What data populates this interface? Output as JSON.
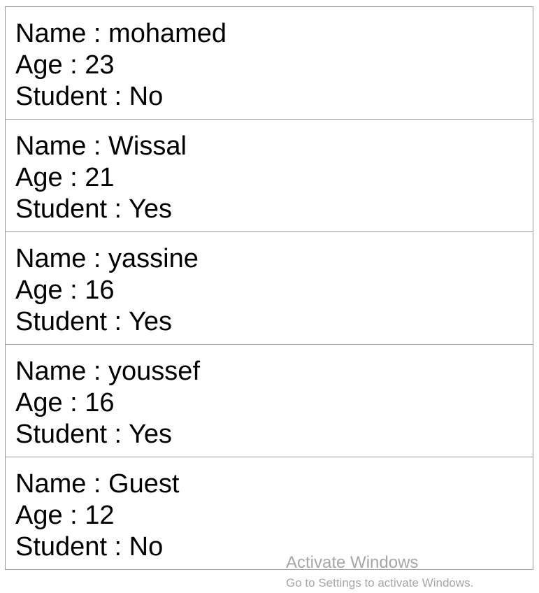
{
  "people": [
    {
      "name": "Name : mohamed",
      "age": "Age : 23",
      "student": "Student : No"
    },
    {
      "name": "Name : Wissal",
      "age": "Age : 21",
      "student": "Student : Yes"
    },
    {
      "name": "Name : yassine",
      "age": "Age : 16",
      "student": "Student : Yes"
    },
    {
      "name": "Name : youssef",
      "age": "Age : 16",
      "student": "Student : Yes"
    },
    {
      "name": "Name : Guest",
      "age": "Age : 12",
      "student": "Student : No"
    }
  ],
  "watermark": {
    "title": "Activate Windows",
    "subtitle": "Go to Settings to activate Windows."
  },
  "colors": {
    "border": "#9a9a9a",
    "text": "#000000",
    "watermark": "#a6a6a6"
  }
}
